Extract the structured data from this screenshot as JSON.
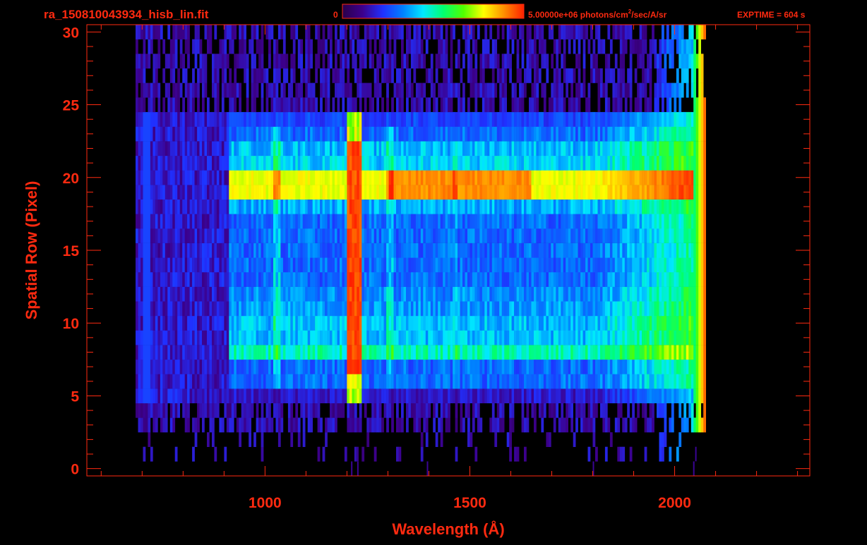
{
  "filename": "ra_150810043934_hisb_lin.fit",
  "colorbar": {
    "min_label": "0",
    "max_label": "5.00000e+06 photons/cm",
    "max_label_sup": "2",
    "max_label_tail": "/sec/A/sr",
    "stops": [
      "#2a004a",
      "#3c008c",
      "#2030ff",
      "#0080ff",
      "#00e8ff",
      "#00ff70",
      "#50ff00",
      "#ffff00",
      "#ff9000",
      "#ff2000"
    ]
  },
  "exptime": "EXPTIME = 604 s",
  "colors": {
    "axis": "#ff2a10",
    "background": "#000000"
  },
  "chart_data": {
    "type": "heatmap",
    "xlabel": "Wavelength (Å)",
    "ylabel": "Spatial Row (Pixel)",
    "xlim": [
      565,
      2330
    ],
    "ylim": [
      -0.5,
      30.5
    ],
    "xticks": [
      1000,
      1500,
      2000
    ],
    "xtick_labels": [
      "1000",
      "1500",
      "2000"
    ],
    "yticks": [
      0,
      5,
      10,
      15,
      20,
      25,
      30
    ],
    "ytick_labels": [
      "0",
      "5",
      "10",
      "15",
      "20",
      "25",
      "30"
    ],
    "colorbar_range": [
      0,
      5000000
    ],
    "bright_features": [
      {
        "name": "Lyman-alpha line",
        "wavelength": 1216,
        "rows": [
          5,
          24
        ]
      },
      {
        "name": "row 19-20 spectrum",
        "rows": [
          19,
          20
        ],
        "wavelength": [
          910,
          2060
        ]
      },
      {
        "name": "row 8 spectrum",
        "rows": [
          8,
          8
        ],
        "wavelength": [
          910,
          2060
        ]
      },
      {
        "name": "detector edge",
        "wavelength": 2060,
        "rows": [
          1,
          30
        ]
      }
    ]
  }
}
